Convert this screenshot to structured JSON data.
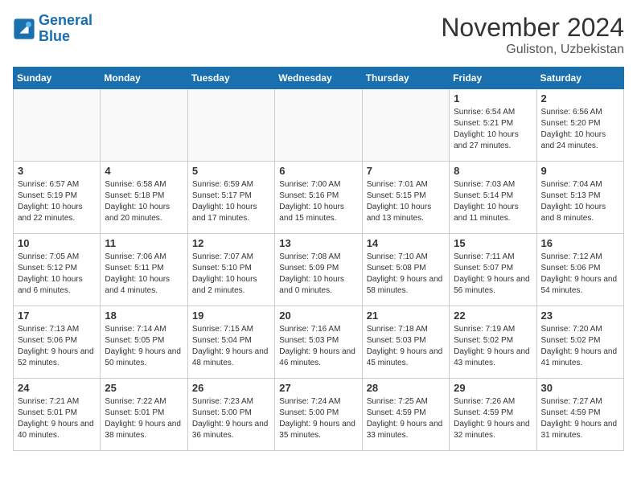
{
  "logo": {
    "line1": "General",
    "line2": "Blue"
  },
  "title": "November 2024",
  "location": "Guliston, Uzbekistan",
  "days_of_week": [
    "Sunday",
    "Monday",
    "Tuesday",
    "Wednesday",
    "Thursday",
    "Friday",
    "Saturday"
  ],
  "weeks": [
    [
      {
        "day": "",
        "info": ""
      },
      {
        "day": "",
        "info": ""
      },
      {
        "day": "",
        "info": ""
      },
      {
        "day": "",
        "info": ""
      },
      {
        "day": "",
        "info": ""
      },
      {
        "day": "1",
        "info": "Sunrise: 6:54 AM\nSunset: 5:21 PM\nDaylight: 10 hours\nand 27 minutes."
      },
      {
        "day": "2",
        "info": "Sunrise: 6:56 AM\nSunset: 5:20 PM\nDaylight: 10 hours\nand 24 minutes."
      }
    ],
    [
      {
        "day": "3",
        "info": "Sunrise: 6:57 AM\nSunset: 5:19 PM\nDaylight: 10 hours\nand 22 minutes."
      },
      {
        "day": "4",
        "info": "Sunrise: 6:58 AM\nSunset: 5:18 PM\nDaylight: 10 hours\nand 20 minutes."
      },
      {
        "day": "5",
        "info": "Sunrise: 6:59 AM\nSunset: 5:17 PM\nDaylight: 10 hours\nand 17 minutes."
      },
      {
        "day": "6",
        "info": "Sunrise: 7:00 AM\nSunset: 5:16 PM\nDaylight: 10 hours\nand 15 minutes."
      },
      {
        "day": "7",
        "info": "Sunrise: 7:01 AM\nSunset: 5:15 PM\nDaylight: 10 hours\nand 13 minutes."
      },
      {
        "day": "8",
        "info": "Sunrise: 7:03 AM\nSunset: 5:14 PM\nDaylight: 10 hours\nand 11 minutes."
      },
      {
        "day": "9",
        "info": "Sunrise: 7:04 AM\nSunset: 5:13 PM\nDaylight: 10 hours\nand 8 minutes."
      }
    ],
    [
      {
        "day": "10",
        "info": "Sunrise: 7:05 AM\nSunset: 5:12 PM\nDaylight: 10 hours\nand 6 minutes."
      },
      {
        "day": "11",
        "info": "Sunrise: 7:06 AM\nSunset: 5:11 PM\nDaylight: 10 hours\nand 4 minutes."
      },
      {
        "day": "12",
        "info": "Sunrise: 7:07 AM\nSunset: 5:10 PM\nDaylight: 10 hours\nand 2 minutes."
      },
      {
        "day": "13",
        "info": "Sunrise: 7:08 AM\nSunset: 5:09 PM\nDaylight: 10 hours\nand 0 minutes."
      },
      {
        "day": "14",
        "info": "Sunrise: 7:10 AM\nSunset: 5:08 PM\nDaylight: 9 hours\nand 58 minutes."
      },
      {
        "day": "15",
        "info": "Sunrise: 7:11 AM\nSunset: 5:07 PM\nDaylight: 9 hours\nand 56 minutes."
      },
      {
        "day": "16",
        "info": "Sunrise: 7:12 AM\nSunset: 5:06 PM\nDaylight: 9 hours\nand 54 minutes."
      }
    ],
    [
      {
        "day": "17",
        "info": "Sunrise: 7:13 AM\nSunset: 5:06 PM\nDaylight: 9 hours\nand 52 minutes."
      },
      {
        "day": "18",
        "info": "Sunrise: 7:14 AM\nSunset: 5:05 PM\nDaylight: 9 hours\nand 50 minutes."
      },
      {
        "day": "19",
        "info": "Sunrise: 7:15 AM\nSunset: 5:04 PM\nDaylight: 9 hours\nand 48 minutes."
      },
      {
        "day": "20",
        "info": "Sunrise: 7:16 AM\nSunset: 5:03 PM\nDaylight: 9 hours\nand 46 minutes."
      },
      {
        "day": "21",
        "info": "Sunrise: 7:18 AM\nSunset: 5:03 PM\nDaylight: 9 hours\nand 45 minutes."
      },
      {
        "day": "22",
        "info": "Sunrise: 7:19 AM\nSunset: 5:02 PM\nDaylight: 9 hours\nand 43 minutes."
      },
      {
        "day": "23",
        "info": "Sunrise: 7:20 AM\nSunset: 5:02 PM\nDaylight: 9 hours\nand 41 minutes."
      }
    ],
    [
      {
        "day": "24",
        "info": "Sunrise: 7:21 AM\nSunset: 5:01 PM\nDaylight: 9 hours\nand 40 minutes."
      },
      {
        "day": "25",
        "info": "Sunrise: 7:22 AM\nSunset: 5:01 PM\nDaylight: 9 hours\nand 38 minutes."
      },
      {
        "day": "26",
        "info": "Sunrise: 7:23 AM\nSunset: 5:00 PM\nDaylight: 9 hours\nand 36 minutes."
      },
      {
        "day": "27",
        "info": "Sunrise: 7:24 AM\nSunset: 5:00 PM\nDaylight: 9 hours\nand 35 minutes."
      },
      {
        "day": "28",
        "info": "Sunrise: 7:25 AM\nSunset: 4:59 PM\nDaylight: 9 hours\nand 33 minutes."
      },
      {
        "day": "29",
        "info": "Sunrise: 7:26 AM\nSunset: 4:59 PM\nDaylight: 9 hours\nand 32 minutes."
      },
      {
        "day": "30",
        "info": "Sunrise: 7:27 AM\nSunset: 4:59 PM\nDaylight: 9 hours\nand 31 minutes."
      }
    ]
  ]
}
